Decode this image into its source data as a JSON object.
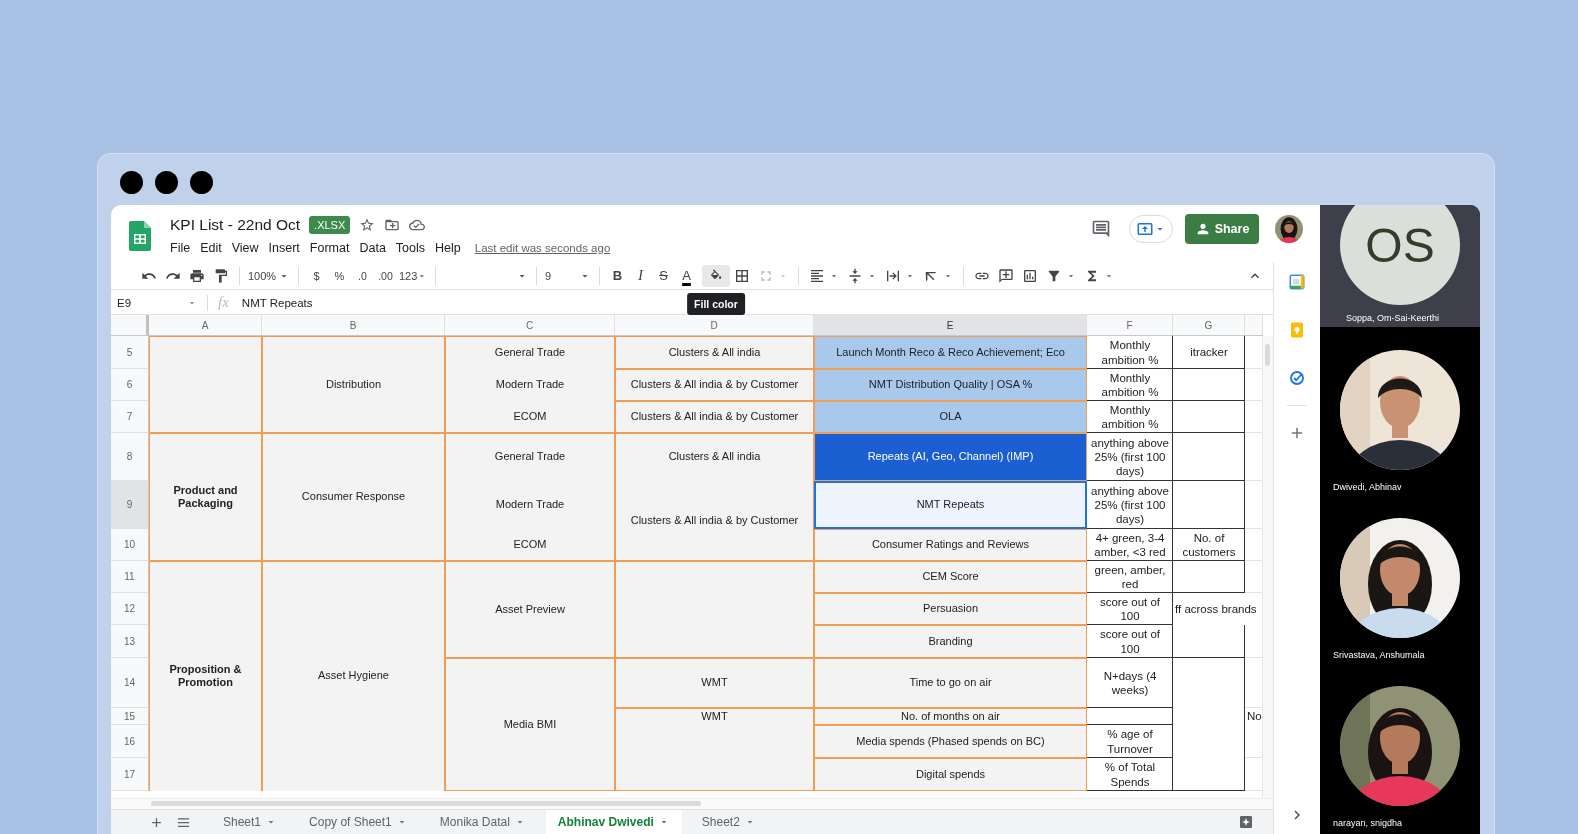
{
  "app": {
    "title": "KPI List - 22nd Oct",
    "badge": ".XLSX",
    "menus": [
      "File",
      "Edit",
      "View",
      "Insert",
      "Format",
      "Data",
      "Tools",
      "Help"
    ],
    "last_edit": "Last edit was seconds ago",
    "share": "Share"
  },
  "toolbar": {
    "zoom": "100%",
    "currency": "$",
    "percent": "%",
    "decrease_decimal": ".0",
    "increase_decimal": ".00",
    "more_formats": "123",
    "font_size": "9",
    "bold": "B",
    "italic": "I",
    "strikethrough": "S",
    "text_color": "A",
    "fill_color": {
      "hovered": true,
      "tooltip": "Fill color"
    }
  },
  "formula_bar": {
    "cell": "E9",
    "fx": "fx",
    "value": "NMT Repeats"
  },
  "columns": [
    {
      "label": "A",
      "selected": false
    },
    {
      "label": "B",
      "selected": false
    },
    {
      "label": "C",
      "selected": false
    },
    {
      "label": "D",
      "selected": false
    },
    {
      "label": "E",
      "selected": true
    },
    {
      "label": "F",
      "selected": false
    },
    {
      "label": "G",
      "selected": false
    }
  ],
  "rows": [
    {
      "label": "5",
      "selected": false,
      "cells": [
        {
          "kind": "orange",
          "color": "#f3f3f3",
          "selected": false
        },
        {
          "text": "Distribution",
          "kind": "orange",
          "color": "#f3f3f3",
          "selected": false
        },
        {
          "text": "General Trade",
          "kind": "orange-open-bottom",
          "color": "#f3f3f3",
          "selected": false
        },
        {
          "text": "Clusters & All india",
          "kind": "orange",
          "color": "#f3f3f3",
          "selected": false
        },
        {
          "text": "Launch Month Reco & Reco Achievement; Eco",
          "kind": "orange",
          "color": "#a9c9ec",
          "selected": false
        },
        {
          "text": "Monthly ambition %",
          "kind": "black",
          "selected": false
        },
        {
          "text": "itracker",
          "kind": "black",
          "selected": false
        },
        {
          "kind": "plain",
          "selected": false
        }
      ]
    },
    {
      "label": "6",
      "selected": false,
      "cells": [
        {
          "kind": "merged"
        },
        {
          "kind": "merged"
        },
        {
          "text": "Modern Trade",
          "kind": "orange-open-both",
          "color": "#f3f3f3",
          "selected": false
        },
        {
          "text": "Clusters & All india & by Customer",
          "kind": "orange",
          "color": "#f3f3f3",
          "selected": false
        },
        {
          "text": "NMT Distribution Quality | OSA %",
          "kind": "orange",
          "color": "#a9c9ec",
          "selected": false
        },
        {
          "text": "Monthly ambition %",
          "kind": "black",
          "selected": false
        },
        {
          "kind": "black",
          "selected": false
        },
        {
          "kind": "plain",
          "selected": false
        }
      ]
    },
    {
      "label": "7",
      "selected": false,
      "cells": [
        {
          "kind": "merged"
        },
        {
          "kind": "merged"
        },
        {
          "text": "ECOM",
          "kind": "orange-open-top",
          "color": "#f3f3f3",
          "selected": false
        },
        {
          "text": "Clusters & All india & by Customer",
          "kind": "orange",
          "color": "#f3f3f3",
          "selected": false
        },
        {
          "text": "OLA",
          "kind": "orange",
          "color": "#a9c9ec",
          "selected": false
        },
        {
          "text": "Monthly ambition %",
          "kind": "black",
          "selected": false
        },
        {
          "kind": "black",
          "selected": false
        },
        {
          "kind": "plain",
          "selected": false
        }
      ]
    },
    {
      "label": "8",
      "selected": false,
      "cells": [
        {
          "text": "Product and Packaging",
          "kind": "orange",
          "color": "#f3f3f3",
          "bold": true,
          "selected": false
        },
        {
          "text": "Consumer Response",
          "kind": "orange",
          "color": "#f3f3f3",
          "selected": false
        },
        {
          "text": "General Trade",
          "kind": "orange-open-bottom",
          "color": "#f3f3f3",
          "selected": false
        },
        {
          "text": "Clusters & All india",
          "kind": "orange-open-bottom",
          "color": "#f3f3f3",
          "selected": false
        },
        {
          "text": "Repeats (AI, Geo, Channel) (IMP)",
          "kind": "orange",
          "color": "#1c5fd2",
          "selected": false
        },
        {
          "text": "anything above 25% (first 100 days)",
          "kind": "black",
          "selected": false
        },
        {
          "kind": "black",
          "selected": false
        },
        {
          "kind": "plain",
          "selected": false
        }
      ]
    },
    {
      "label": "9",
      "selected": true,
      "cells": [
        {
          "kind": "merged"
        },
        {
          "kind": "merged"
        },
        {
          "text": "Modern Trade",
          "kind": "orange-open-both",
          "color": "#f3f3f3",
          "selected": false
        },
        {
          "text": "Clusters & All india & by Customer",
          "kind": "orange-open-top",
          "color": "#f3f3f3",
          "selected": false
        },
        {
          "text": "NMT Repeats",
          "kind": "orange",
          "color": "#f3f3f3",
          "selected": true
        },
        {
          "text": "anything above 25% (first 100 days)",
          "kind": "black",
          "selected": false
        },
        {
          "kind": "black",
          "selected": false
        },
        {
          "kind": "plain",
          "selected": false
        }
      ]
    },
    {
      "label": "10",
      "selected": false,
      "cells": [
        {
          "kind": "merged"
        },
        {
          "kind": "merged"
        },
        {
          "text": "ECOM",
          "kind": "orange-open-top",
          "color": "#f3f3f3",
          "selected": false
        },
        {
          "kind": "merged"
        },
        {
          "text": "Consumer Ratings and Reviews",
          "kind": "orange",
          "color": "#f3f3f3",
          "selected": false
        },
        {
          "text": "4+ green, 3-4 amber, <3 red",
          "kind": "black",
          "selected": false
        },
        {
          "text": "No. of customers",
          "kind": "black",
          "selected": false
        },
        {
          "kind": "plain",
          "selected": false
        }
      ]
    },
    {
      "label": "11",
      "selected": false,
      "cells": [
        {
          "text": "Proposition & Promotion",
          "kind": "orange-open-bottom",
          "color": "#f3f3f3",
          "bold": true,
          "selected": false
        },
        {
          "text": "Asset Hygiene",
          "kind": "orange-open-bottom",
          "color": "#f3f3f3",
          "selected": false
        },
        {
          "text": "Asset Preview",
          "kind": "orange",
          "color": "#f3f3f3",
          "selected": false
        },
        {
          "kind": "orange",
          "color": "#f3f3f3",
          "selected": false
        },
        {
          "text": "CEM Score",
          "kind": "orange",
          "color": "#f3f3f3",
          "selected": false
        },
        {
          "text": "green, amber, red",
          "kind": "black",
          "selected": false
        },
        {
          "kind": "black",
          "selected": false
        },
        {
          "kind": "plain",
          "selected": false
        }
      ]
    },
    {
      "label": "12",
      "selected": false,
      "cells": [
        {
          "kind": "merged"
        },
        {
          "kind": "merged"
        },
        {
          "kind": "merged"
        },
        {
          "kind": "merged"
        },
        {
          "text": "Persuasion",
          "kind": "orange",
          "color": "#f3f3f3",
          "selected": false
        },
        {
          "text": "score out of 100",
          "kind": "black",
          "selected": false
        },
        {
          "text": "ff across brands",
          "kind": "overflow",
          "selected": false
        },
        {
          "kind": "covered"
        }
      ]
    },
    {
      "label": "13",
      "selected": false,
      "cells": [
        {
          "kind": "merged"
        },
        {
          "kind": "merged"
        },
        {
          "kind": "merged"
        },
        {
          "kind": "merged"
        },
        {
          "text": "Branding",
          "kind": "orange",
          "color": "#f3f3f3",
          "selected": false
        },
        {
          "text": "score out of 100",
          "kind": "black",
          "selected": false
        },
        {
          "kind": "black",
          "selected": false
        },
        {
          "kind": "plain",
          "selected": false
        }
      ]
    },
    {
      "label": "14",
      "selected": false,
      "cells": [
        {
          "kind": "merged"
        },
        {
          "kind": "merged"
        },
        {
          "text": "Media BMI",
          "kind": "orange",
          "color": "#f3f3f3",
          "selected": false
        },
        {
          "text": "WMT",
          "kind": "orange",
          "color": "#f3f3f3",
          "selected": false
        },
        {
          "text": "Time to go on air",
          "kind": "orange",
          "color": "#f3f3f3",
          "selected": false
        },
        {
          "text": "N+days (4 weeks)",
          "kind": "black",
          "selected": false
        },
        {
          "kind": "black",
          "selected": false
        },
        {
          "kind": "plain",
          "selected": false
        }
      ]
    },
    {
      "label": "15",
      "selected": false,
      "cells": [
        {
          "kind": "merged"
        },
        {
          "kind": "merged"
        },
        {
          "kind": "merged"
        },
        {
          "text": "WMT",
          "kind": "orange-open-bottom",
          "color": "#f3f3f3",
          "selected": false
        },
        {
          "text": "No. of months on air",
          "kind": "orange",
          "color": "#f3f3f3",
          "selected": false
        },
        {
          "kind": "black",
          "selected": false
        },
        {
          "kind": "merged"
        },
        {
          "text": "No",
          "kind": "overflow",
          "selected": false
        }
      ]
    },
    {
      "label": "16",
      "selected": false,
      "cells": [
        {
          "kind": "merged"
        },
        {
          "kind": "merged"
        },
        {
          "kind": "merged"
        },
        {
          "kind": "orange-open-top",
          "color": "#f3f3f3",
          "selected": false
        },
        {
          "text": "Media spends (Phased spends on BC)",
          "kind": "orange",
          "color": "#f3f3f3",
          "selected": false
        },
        {
          "text": "% age of Turnover",
          "kind": "black",
          "selected": false
        },
        {
          "kind": "merged"
        },
        {
          "kind": "plain",
          "selected": false
        }
      ]
    },
    {
      "label": "17",
      "selected": false,
      "cells": [
        {
          "kind": "merged"
        },
        {
          "kind": "merged"
        },
        {
          "kind": "merged"
        },
        {
          "kind": "merged"
        },
        {
          "text": "Digital spends",
          "kind": "orange",
          "color": "#f3f3f3",
          "selected": false
        },
        {
          "text": "% of Total Spends",
          "kind": "black",
          "selected": false
        },
        {
          "kind": "merged"
        },
        {
          "kind": "plain",
          "selected": false
        }
      ]
    }
  ],
  "sheet_tabs": [
    {
      "label": "Sheet1",
      "selected": false
    },
    {
      "label": "Copy of Sheet1",
      "selected": false
    },
    {
      "label": "Monika Datal",
      "selected": false
    },
    {
      "label": "Abhinav Dwivedi",
      "selected": true
    },
    {
      "label": "Sheet2",
      "selected": false
    }
  ],
  "participants": [
    {
      "kind": "initials",
      "initials": "OS",
      "name": "Soppa, Om-Sai-Keerthi"
    },
    {
      "kind": "video",
      "name": "Dwivedi, Abhinav"
    },
    {
      "kind": "video",
      "name": "Srivastava, Anshumala"
    },
    {
      "kind": "video",
      "name": "narayan, snigdha"
    }
  ]
}
